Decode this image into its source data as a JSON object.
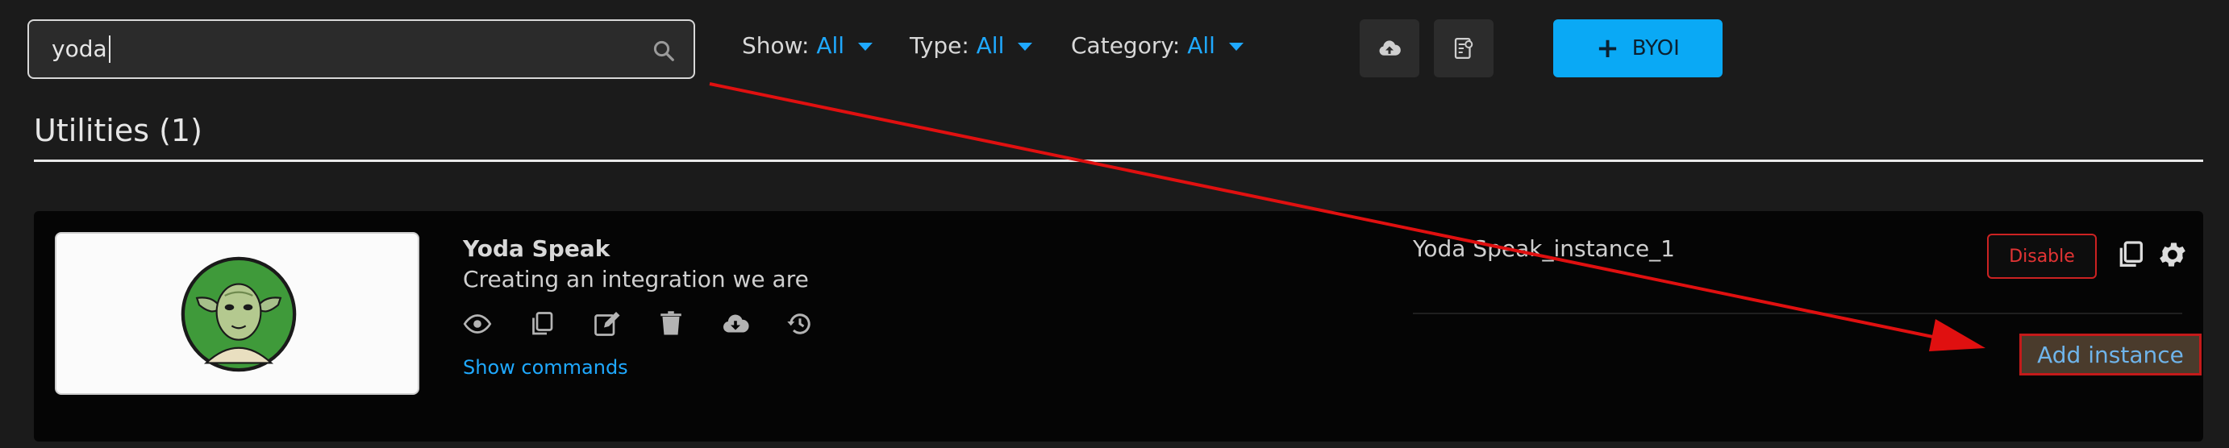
{
  "search": {
    "value": "yoda"
  },
  "filters": [
    {
      "label": "Show:",
      "value": "All"
    },
    {
      "label": "Type:",
      "value": "All"
    },
    {
      "label": "Category:",
      "value": "All"
    }
  ],
  "toolbar": {
    "upload_icon": "cloud-upload-icon",
    "docs_icon": "document-gear-icon",
    "byoi_label": "BYOI",
    "byoi_icon": "plus-icon"
  },
  "section": {
    "title": "Utilities (1)"
  },
  "integration": {
    "name": "Yoda Speak",
    "description": "Creating an integration we are",
    "logo": "yoda-avatar",
    "actions": [
      "eye-icon",
      "copy-icon",
      "edit-icon",
      "trash-icon",
      "cloud-download-icon",
      "history-icon"
    ],
    "show_commands_label": "Show commands",
    "instance": {
      "name": "Yoda Speak_instance_1",
      "disable_label": "Disable",
      "add_instance_label": "Add instance"
    }
  },
  "colors": {
    "accent": "#1fa9ff",
    "byoi_bg": "#0aa9f5",
    "annotation_red": "#e01010",
    "disable_red": "#e33434"
  }
}
